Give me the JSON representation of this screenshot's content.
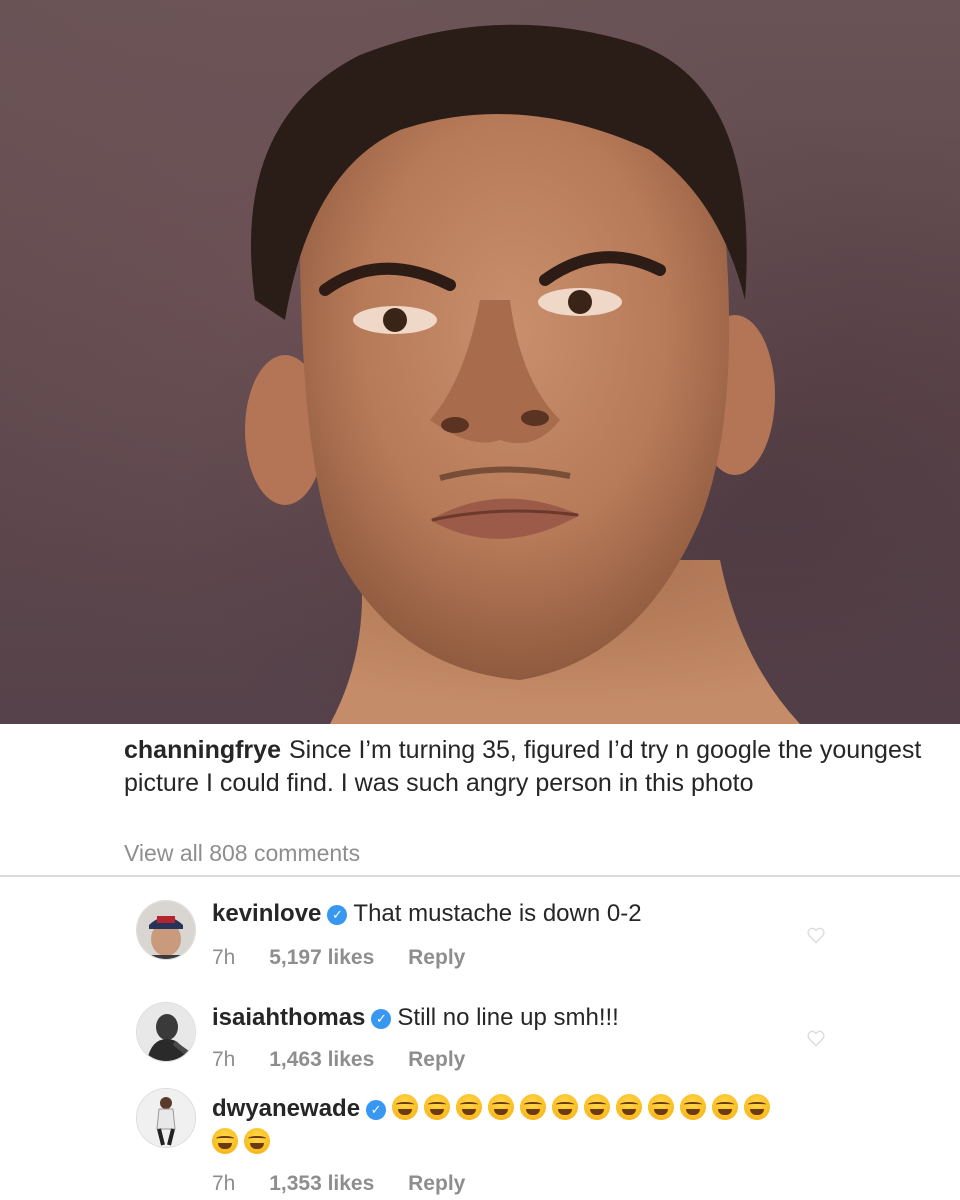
{
  "post": {
    "username": "channingfrye",
    "caption": "Since I’m turning 35, figured I’d try n google the youngest picture I could find. I was such angry person in this photo",
    "view_all_comments": "View all 808 comments"
  },
  "comments": [
    {
      "username": "kevinlove",
      "verified": true,
      "text": "That mustache is down 0-2",
      "time": "7h",
      "likes": "5,197 likes",
      "reply": "Reply"
    },
    {
      "username": "isaiahthomas",
      "verified": true,
      "text": "Still no line up smh!!!",
      "time": "7h",
      "likes": "1,463 likes",
      "reply": "Reply"
    },
    {
      "username": "dwyanewade",
      "verified": true,
      "emoji_count": 14,
      "emoji_name": "face-with-tears-of-joy",
      "time": "7h",
      "likes": "1,353 likes",
      "reply": "Reply"
    }
  ],
  "colors": {
    "text": "#262626",
    "muted": "#8e8e8e",
    "verified": "#3897f0",
    "photo_bg": "#5f494d"
  }
}
